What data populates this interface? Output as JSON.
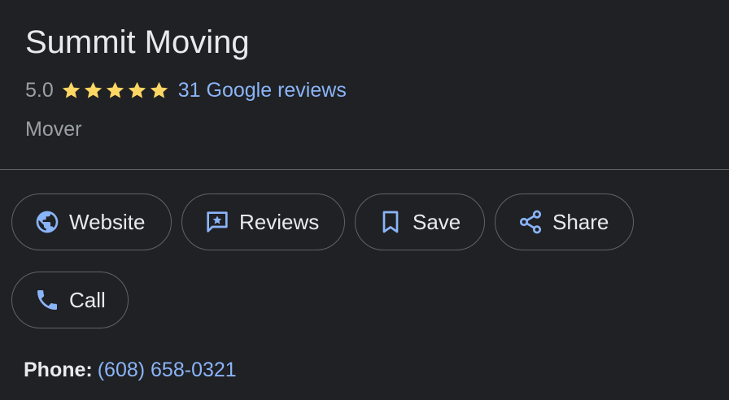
{
  "business": {
    "name": "Summit Moving",
    "rating": "5.0",
    "star_count": 5,
    "reviews_link": "31 Google reviews",
    "category": "Mover"
  },
  "actions": {
    "website": {
      "label": "Website",
      "icon": "globe-icon"
    },
    "reviews": {
      "label": "Reviews",
      "icon": "review-icon"
    },
    "save": {
      "label": "Save",
      "icon": "bookmark-icon"
    },
    "share": {
      "label": "Share",
      "icon": "share-icon"
    },
    "call": {
      "label": "Call",
      "icon": "phone-icon"
    }
  },
  "phone": {
    "label": "Phone:",
    "value": "(608) 658-0321"
  },
  "colors": {
    "background": "#202124",
    "text": "#e8eaed",
    "muted": "#9aa0a6",
    "link": "#8ab4f8",
    "star": "#fdd663",
    "border": "#5f6368"
  }
}
